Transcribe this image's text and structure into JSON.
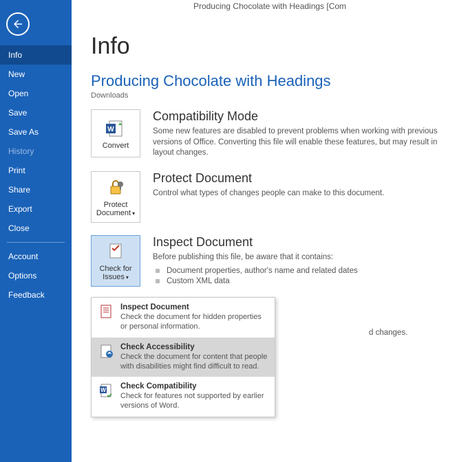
{
  "window": {
    "title": "Producing Chocolate with Headings [Com"
  },
  "sidebar": {
    "items": [
      {
        "label": "Info",
        "selected": true
      },
      {
        "label": "New"
      },
      {
        "label": "Open"
      },
      {
        "label": "Save"
      },
      {
        "label": "Save As"
      },
      {
        "label": "History",
        "disabled": true
      },
      {
        "label": "Print"
      },
      {
        "label": "Share"
      },
      {
        "label": "Export"
      },
      {
        "label": "Close"
      }
    ],
    "bottom": [
      {
        "label": "Account"
      },
      {
        "label": "Options"
      },
      {
        "label": "Feedback"
      }
    ]
  },
  "page": {
    "title": "Info",
    "doc_title": "Producing Chocolate with Headings",
    "location": "Downloads"
  },
  "sections": {
    "compat": {
      "button": "Convert",
      "heading": "Compatibility Mode",
      "body": "Some new features are disabled to prevent problems when working with previous versions of Office. Converting this file will enable these features, but may result in layout changes."
    },
    "protect": {
      "button": "Protect Document",
      "heading": "Protect Document",
      "body": "Control what types of changes people can make to this document."
    },
    "inspect": {
      "button": "Check for Issues",
      "heading": "Inspect Document",
      "intro": "Before publishing this file, be aware that it contains:",
      "items": [
        "Document properties, author's name and related dates",
        "Custom XML data"
      ],
      "trailing": "d changes."
    }
  },
  "dropdown": {
    "items": [
      {
        "title": "Inspect Document",
        "desc": "Check the document for hidden properties or personal information."
      },
      {
        "title": "Check Accessibility",
        "desc": "Check the document for content that people with disabilities might find difficult to read.",
        "hover": true
      },
      {
        "title": "Check Compatibility",
        "desc": "Check for features not supported by earlier versions of Word."
      }
    ]
  }
}
